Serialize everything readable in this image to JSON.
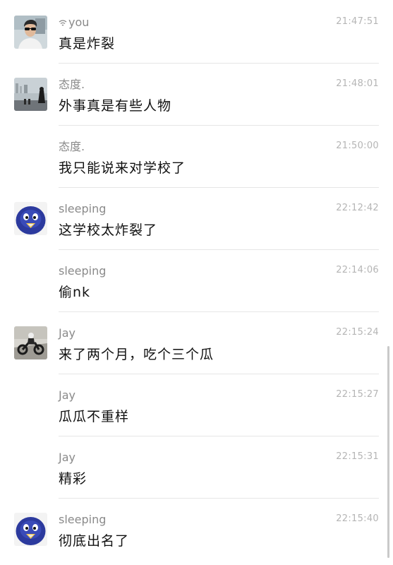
{
  "messages": [
    {
      "sender": "you",
      "time": "21:47:51",
      "text": "真是炸裂",
      "avatar": "avatar-man-sunglasses",
      "has_avatar": true,
      "sender_icon": "wifi-icon"
    },
    {
      "sender": "态度.",
      "time": "21:48:01",
      "text": "外事真是有些人物",
      "avatar": "avatar-waterfront",
      "has_avatar": true
    },
    {
      "sender": "态度.",
      "time": "21:50:00",
      "text": "我只能说来对学校了",
      "has_avatar": false
    },
    {
      "sender": "sleeping",
      "time": "22:12:42",
      "text": "这学校太炸裂了",
      "avatar": "avatar-blue-penguin",
      "has_avatar": true
    },
    {
      "sender": "sleeping",
      "time": "22:14:06",
      "text": "偷nk",
      "has_avatar": false
    },
    {
      "sender": "Jay",
      "time": "22:15:24",
      "text": "来了两个月，吃个三个瓜",
      "avatar": "avatar-motorcycle",
      "has_avatar": true
    },
    {
      "sender": "Jay",
      "time": "22:15:27",
      "text": "瓜瓜不重样",
      "has_avatar": false
    },
    {
      "sender": "Jay",
      "time": "22:15:31",
      "text": "精彩",
      "has_avatar": false
    },
    {
      "sender": "sleeping",
      "time": "22:15:40",
      "text": "彻底出名了",
      "avatar": "avatar-blue-penguin",
      "has_avatar": true
    }
  ],
  "colors": {
    "sender": "#8a8a8a",
    "time": "#b5b5b5",
    "text": "#111111",
    "divider": "#e6e6e6",
    "penguin_blue": "#2c3a9e"
  }
}
